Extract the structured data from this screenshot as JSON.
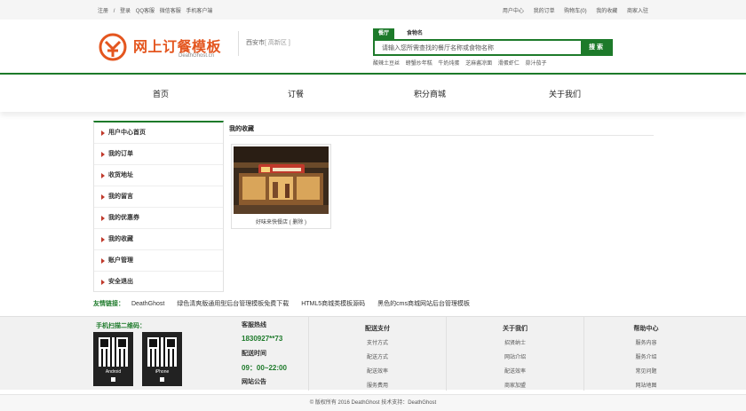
{
  "topbar": {
    "left": [
      "注册",
      "/",
      "登录",
      "QQ客服",
      "微信客服",
      "手机客户端"
    ],
    "right": [
      "用户中心",
      "我的订单",
      "购物车(0)",
      "我的收藏",
      "商家入驻"
    ]
  },
  "logo": {
    "name": "网上订餐模板",
    "sub": "DeathGhost.cn",
    "brand_color": "#e4561f"
  },
  "city": {
    "name": "西安市",
    "area": "[ 高新区 ]"
  },
  "search": {
    "tabs": [
      "餐厅",
      "食物名"
    ],
    "placeholder": "请输入您所需查找的餐厅名称或食物名称",
    "button": "搜 索",
    "hot": [
      "酸辣土豆丝",
      "螃蟹炒年糕",
      "牛奶炖蛋",
      "芝麻酱凉面",
      "滑蛋虾仁",
      "蒜汁茄子"
    ]
  },
  "nav": [
    "首页",
    "订餐",
    "积分商城",
    "关于我们"
  ],
  "sidebar": [
    "用户中心首页",
    "我的订单",
    "收货地址",
    "我的留言",
    "我的优惠券",
    "我的收藏",
    "账户管理",
    "安全退出"
  ],
  "main": {
    "title": "我的收藏",
    "favorites": [
      {
        "caption": "好味来快餐店 ( 删除 )"
      }
    ]
  },
  "links": {
    "label": "友情链接：",
    "items": [
      "DeathGhost",
      "绿色清爽版通用型后台管理模板免费下载",
      "HTML5商城类模板源码",
      "黑色的cms商城网站后台管理模板"
    ]
  },
  "footer": {
    "qr_title": "手机扫描二维码：",
    "qr": [
      "Android",
      "iPhone"
    ],
    "hotline_title": "客服热线",
    "hotline": "1830927**73",
    "delivery_title": "配送时间",
    "delivery_time": "09：00~22:00",
    "notice": "网站公告",
    "cols": [
      {
        "title": "配送支付",
        "items": [
          "支付方式",
          "配送方式",
          "配送效率",
          "服务费用"
        ]
      },
      {
        "title": "关于我们",
        "items": [
          "招贤纳士",
          "网站介绍",
          "配送效率",
          "商家加盟"
        ]
      },
      {
        "title": "帮助中心",
        "items": [
          "服务内容",
          "服务介绍",
          "常见问题",
          "网站地图"
        ]
      }
    ]
  },
  "copyright": "© 版权所有 2016 DeathGhost 技术支持：DeathGhost",
  "colors": {
    "accent": "#1d7a2a",
    "brand": "#e4561f",
    "arrow": "#c0392b"
  }
}
